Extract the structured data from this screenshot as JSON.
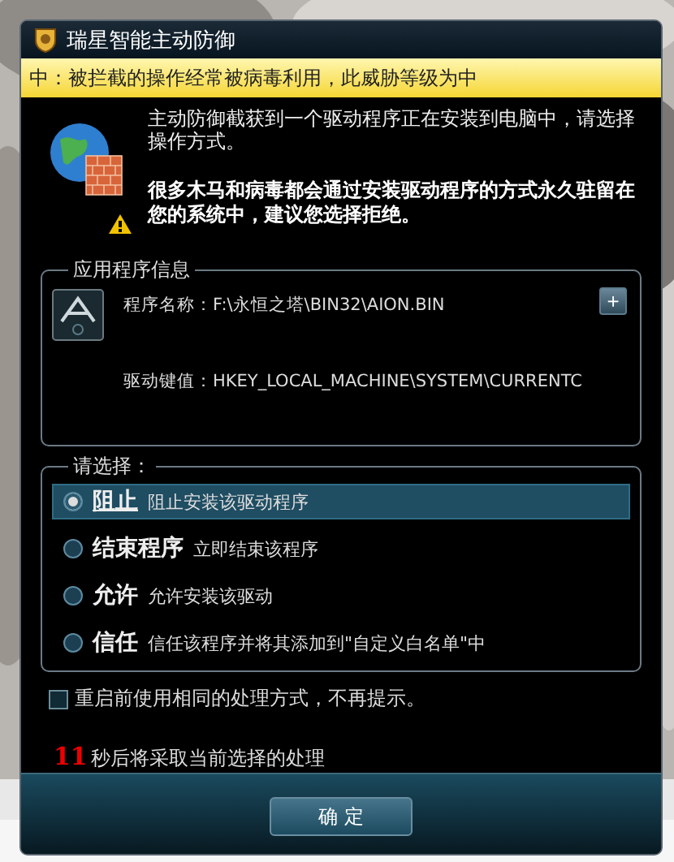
{
  "window": {
    "title": "瑞星智能主动防御"
  },
  "threat_banner": {
    "text": "中：被拦截的操作经常被病毒利用，此威胁等级为中"
  },
  "intro": {
    "message": "主动防御截获到一个驱动程序正在安装到电脑中，请选择操作方式。",
    "warning": "很多木马和病毒都会通过安装驱动程序的方式永久驻留在您的系统中，建议您选择拒绝。"
  },
  "app_info": {
    "legend": "应用程序信息",
    "program_label": "程序名称：",
    "program_value": "F:\\永恒之塔\\BIN32\\AION.BIN",
    "key_label": "驱动键值：",
    "key_value": "HKEY_LOCAL_MACHINE\\SYSTEM\\CURRENTC",
    "expand_button": "+"
  },
  "choices": {
    "legend": "请选择：",
    "options": [
      {
        "title": "阻止",
        "description": "阻止安装该驱动程序",
        "selected": true
      },
      {
        "title": "结束程序",
        "description": "立即结束该程序",
        "selected": false
      },
      {
        "title": "允许",
        "description": "允许安装该驱动",
        "selected": false
      },
      {
        "title": "信任",
        "description": "信任该程序并将其添加到\"自定义白名单\"中",
        "selected": false
      }
    ]
  },
  "remember": {
    "label": "重启前使用相同的处理方式，不再提示。",
    "checked": false
  },
  "countdown": {
    "seconds": "11",
    "text": "秒后将采取当前选择的处理"
  },
  "buttons": [
    "确 定"
  ]
}
